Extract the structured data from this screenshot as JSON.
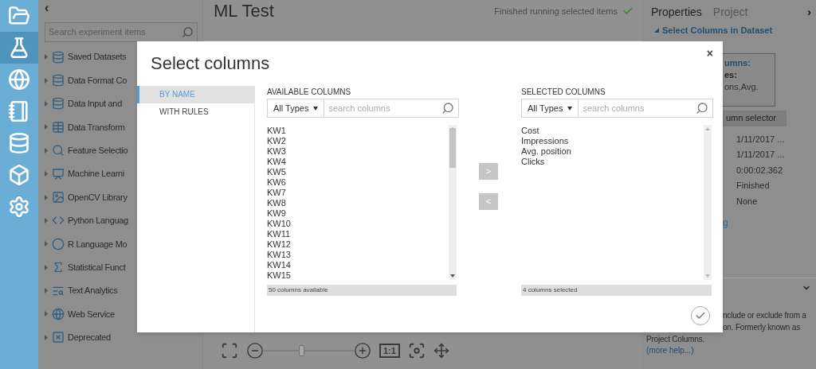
{
  "nav_rail": [
    {
      "selected": false
    },
    {
      "selected": true
    },
    {
      "selected": false
    },
    {
      "selected": false
    },
    {
      "selected": false
    },
    {
      "selected": false
    },
    {
      "selected": false
    }
  ],
  "palette": {
    "collapse": "‹",
    "search_placeholder": "Search experiment items",
    "items": [
      "Saved Datasets",
      "Data Format Co",
      "Data Input and",
      "Data Transform",
      "Feature Selectio",
      "Machine Learni",
      "OpenCV Library",
      "Python Languag",
      "R Language Mo",
      "Statistical Funct",
      "Text Analytics",
      "Web Service",
      "Deprecated"
    ]
  },
  "canvas": {
    "title": "ML Test",
    "status": "Finished running selected items",
    "zoom": {
      "level": 0.42
    },
    "actual_size": "1:1"
  },
  "properties": {
    "tabs": [
      {
        "label": "Properties",
        "selected": true
      },
      {
        "label": "Project",
        "selected": false
      }
    ],
    "collapse": "›",
    "module": "Select Columns in Dataset",
    "box_lines": [
      "umns:",
      "es:",
      "ons,Avg."
    ],
    "selector_button": "umn selector",
    "values": [
      "1/11/2017 ...",
      "1/11/2017 ...",
      "0:00:02.362",
      "Finished",
      "None"
    ],
    "link": "g",
    "help_lines": [
      "nclude or exclude from a",
      "on. Formerly known as",
      "Project Columns."
    ],
    "help_link": "(more help...)"
  },
  "dialog": {
    "title": "Select columns",
    "close": "×",
    "modes": [
      {
        "label": "BY NAME",
        "selected": true
      },
      {
        "label": "WITH RULES",
        "selected": false
      }
    ],
    "available": {
      "heading": "AVAILABLE COLUMNS",
      "type_filter": "All Types",
      "search_placeholder": "search columns",
      "items": [
        "KW1",
        "KW2",
        "KW3",
        "KW4",
        "KW5",
        "KW6",
        "KW7",
        "KW8",
        "KW9",
        "KW10",
        "KW11",
        "KW12",
        "KW13",
        "KW14",
        "KW15"
      ],
      "footer": "50 columns available"
    },
    "move_buttons": [
      ">",
      "<"
    ],
    "selected": {
      "heading": "SELECTED COLUMNS",
      "type_filter": "All Types",
      "search_placeholder": "search columns",
      "items": [
        "Cost",
        "Impressions",
        "Avg. position",
        "Clicks"
      ],
      "footer": "4 columns selected"
    }
  }
}
